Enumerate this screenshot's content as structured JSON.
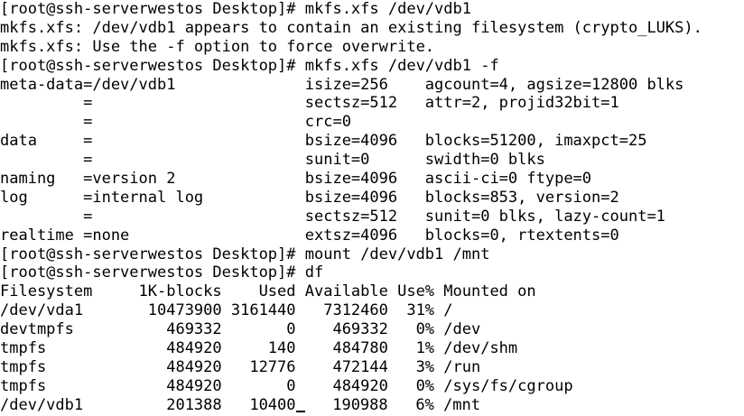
{
  "terminal": {
    "lines": [
      "[root@ssh-serverwestos Desktop]# mkfs.xfs /dev/vdb1",
      "mkfs.xfs: /dev/vdb1 appears to contain an existing filesystem (crypto_LUKS).",
      "mkfs.xfs: Use the -f option to force overwrite.",
      "[root@ssh-serverwestos Desktop]# mkfs.xfs /dev/vdb1 -f",
      "meta-data=/dev/vdb1              isize=256    agcount=4, agsize=12800 blks",
      "         =                       sectsz=512   attr=2, projid32bit=1",
      "         =                       crc=0",
      "data     =                       bsize=4096   blocks=51200, imaxpct=25",
      "         =                       sunit=0      swidth=0 blks",
      "naming   =version 2              bsize=4096   ascii-ci=0 ftype=0",
      "log      =internal log           bsize=4096   blocks=853, version=2",
      "         =                       sectsz=512   sunit=0 blks, lazy-count=1",
      "realtime =none                   extsz=4096   blocks=0, rtextents=0",
      "[root@ssh-serverwestos Desktop]# mount /dev/vdb1 /mnt",
      "[root@ssh-serverwestos Desktop]# df",
      "Filesystem     1K-blocks    Used Available Use% Mounted on",
      "/dev/vda1       10473900 3161440   7312460  31% /",
      "devtmpfs          469332       0    469332   0% /dev",
      "tmpfs             484920     140    484780   1% /dev/shm",
      "tmpfs             484920   12776    472144   3% /run",
      "tmpfs             484920       0    484920   0% /sys/fs/cgroup"
    ],
    "last_line_before_cursor": "/dev/vdb1         201388   10400",
    "last_line_after_cursor": "   190988   6% /mnt"
  }
}
